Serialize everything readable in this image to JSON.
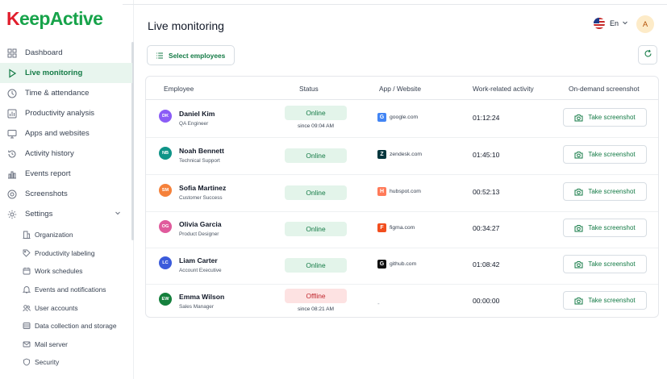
{
  "brand": {
    "logo_k": "K",
    "logo_rest": "eepActive"
  },
  "sidebar": {
    "items": [
      {
        "label": "Dashboard",
        "icon": "grid-icon"
      },
      {
        "label": "Live monitoring",
        "icon": "play-icon"
      },
      {
        "label": "Time & attendance",
        "icon": "clock-icon"
      },
      {
        "label": "Productivity analysis",
        "icon": "chart-icon"
      },
      {
        "label": "Apps and websites",
        "icon": "monitor-icon"
      },
      {
        "label": "Activity history",
        "icon": "history-icon"
      },
      {
        "label": "Events report",
        "icon": "report-icon"
      },
      {
        "label": "Screenshots",
        "icon": "camera-icon"
      },
      {
        "label": "Settings",
        "icon": "gear-icon"
      }
    ],
    "settings": [
      {
        "label": "Organization"
      },
      {
        "label": "Productivity labeling"
      },
      {
        "label": "Work schedules"
      },
      {
        "label": "Events and notifications"
      },
      {
        "label": "User accounts"
      },
      {
        "label": "Data collection and storage"
      },
      {
        "label": "Mail server"
      },
      {
        "label": "Security"
      }
    ]
  },
  "header": {
    "title": "Live monitoring",
    "language": "En",
    "avatar_initial": "A"
  },
  "toolbar": {
    "select_label": "Select employees"
  },
  "table": {
    "headers": [
      "Employee",
      "Status",
      "App / Website",
      "Work-related activity",
      "On-demand screenshot"
    ],
    "button_label": "Take screenshot",
    "rows": [
      {
        "initials": "DK",
        "avatar_color": "#8b5cf6",
        "name": "Daniel Kim",
        "role": "QA Engineer",
        "status": "Online",
        "since": "since 09:04 AM",
        "app": "google.com",
        "app_glyph": "G",
        "app_color": "#4285f4",
        "activity": "01:12:24"
      },
      {
        "initials": "NB",
        "avatar_color": "#0f9488",
        "name": "Noah Bennett",
        "role": "Technical Support",
        "status": "Online",
        "since": "",
        "app": "zendesk.com",
        "app_glyph": "Z",
        "app_color": "#03363d",
        "activity": "01:45:10"
      },
      {
        "initials": "SM",
        "avatar_color": "#f5813a",
        "name": "Sofia Martinez",
        "role": "Customer Success",
        "status": "Online",
        "since": "",
        "app": "hubspot.com",
        "app_glyph": "H",
        "app_color": "#ff7a59",
        "activity": "00:52:13"
      },
      {
        "initials": "OG",
        "avatar_color": "#e05a9c",
        "name": "Olivia Garcia",
        "role": "Product Designer",
        "status": "Online",
        "since": "",
        "app": "figma.com",
        "app_glyph": "F",
        "app_color": "#f24e1e",
        "activity": "00:34:27"
      },
      {
        "initials": "LC",
        "avatar_color": "#3b5bdb",
        "name": "Liam Carter",
        "role": "Account Executive",
        "status": "Online",
        "since": "",
        "app": "github.com",
        "app_glyph": "G",
        "app_color": "#111111",
        "activity": "01:08:42"
      },
      {
        "initials": "EW",
        "avatar_color": "#15803d",
        "name": "Emma Wilson",
        "role": "Sales Manager",
        "status": "Offline",
        "since": "since 08:21 AM",
        "app": "-",
        "app_glyph": "",
        "app_color": "",
        "activity": "00:00:00"
      }
    ]
  },
  "colors": {
    "accent": "#137a45",
    "online_bg": "#e3f4ea",
    "offline_bg": "#fde2e2",
    "offline_text": "#c0262d"
  }
}
